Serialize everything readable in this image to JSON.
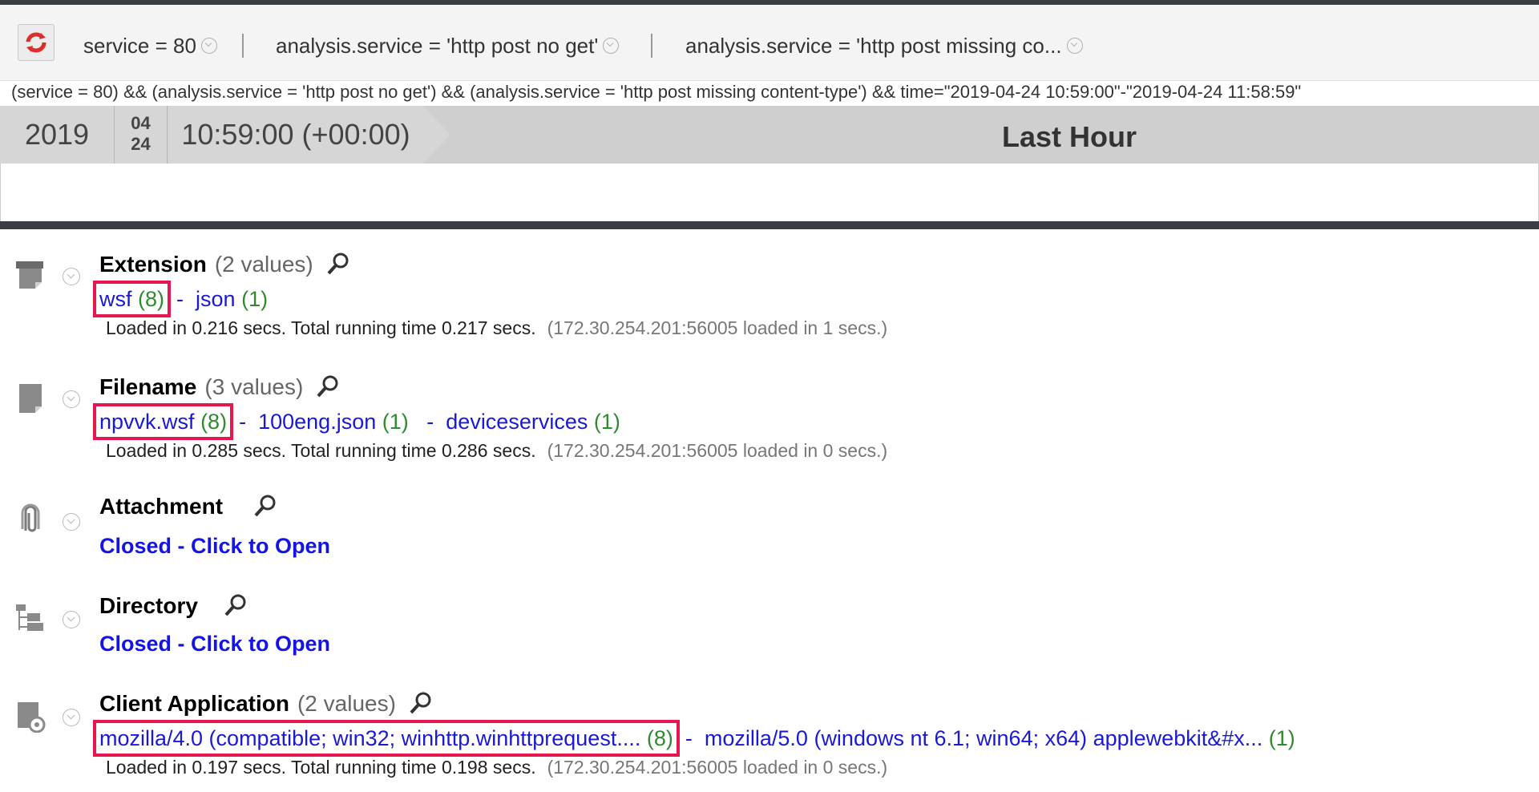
{
  "breadcrumbs": [
    {
      "label": "service = 80"
    },
    {
      "label": "analysis.service = 'http post no get'"
    },
    {
      "label": "analysis.service = 'http post missing co..."
    }
  ],
  "query_text": "(service = 80) && (analysis.service = 'http post no get') && (analysis.service = 'http post missing content-type') && time=\"2019-04-24 10:59:00\"-\"2019-04-24 11:58:59\"",
  "timebar": {
    "year": "2019",
    "month": "04",
    "day": "24",
    "time": "10:59:00 (+00:00)",
    "range_label": "Last Hour"
  },
  "sections": {
    "extension": {
      "title": "Extension",
      "count": "(2 values)",
      "values": [
        {
          "name": "wsf",
          "count": "(8)"
        },
        {
          "name": "json",
          "count": "(1)"
        }
      ],
      "load_info": "Loaded in 0.216 secs. Total running time 0.217 secs.",
      "load_server": "(172.30.254.201:56005 loaded in 1 secs.)"
    },
    "filename": {
      "title": "Filename",
      "count": "(3 values)",
      "values": [
        {
          "name": "npvvk.wsf",
          "count": "(8)"
        },
        {
          "name": "100eng.json",
          "count": "(1)"
        },
        {
          "name": "deviceservices",
          "count": "(1)"
        }
      ],
      "load_info": "Loaded in 0.285 secs. Total running time 0.286 secs.",
      "load_server": "(172.30.254.201:56005 loaded in 0 secs.)"
    },
    "attachment": {
      "title": "Attachment",
      "closed_label": "Closed - Click to Open"
    },
    "directory": {
      "title": "Directory",
      "closed_label": "Closed - Click to Open"
    },
    "client_application": {
      "title": "Client Application",
      "count": "(2 values)",
      "values": [
        {
          "name": "mozilla/4.0 (compatible; win32; winhttp.winhttprequest....",
          "count": "(8)"
        },
        {
          "name": "mozilla/5.0 (windows nt 6.1; win64; x64) applewebkit&#x...",
          "count": "(1)"
        }
      ],
      "load_info": "Loaded in 0.197 secs. Total running time 0.198 secs.",
      "load_server": "(172.30.254.201:56005 loaded in 0 secs.)"
    }
  },
  "colors": {
    "link": "#1a1ad6",
    "count": "#2e8b2e",
    "highlight": "#e8164f",
    "refresh_accent": "#d9302c"
  },
  "icons": {
    "refresh": "refresh-icon",
    "search": "magnifier-icon",
    "extension": "file-tag-icon",
    "filename": "file-icon",
    "attachment": "paperclip-icon",
    "directory": "folder-tree-icon",
    "client_application": "application-disc-icon"
  }
}
